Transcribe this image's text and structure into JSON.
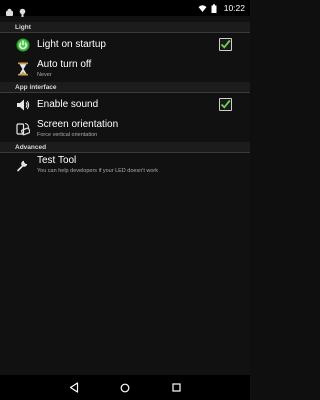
{
  "status_bar": {
    "time": "10:22",
    "icons": [
      "android-notification-icon",
      "android-notification-icon",
      "wifi-icon",
      "battery-icon"
    ]
  },
  "sections": [
    {
      "header": "Light",
      "items": [
        {
          "title": "Light on startup",
          "summary": "",
          "icon": "power-icon",
          "checked": true
        },
        {
          "title": "Auto turn off",
          "summary": "Never",
          "icon": "hourglass-icon"
        }
      ]
    },
    {
      "header": "App interface",
      "items": [
        {
          "title": "Enable sound",
          "summary": "",
          "icon": "speaker-icon",
          "checked": true
        },
        {
          "title": "Screen orientation",
          "summary": "Force vertical orientation",
          "icon": "rotate-phone-icon"
        }
      ]
    },
    {
      "header": "Advanced",
      "items": [
        {
          "title": "Test Tool",
          "summary": "You can help developers if your LED doesn't work",
          "icon": "wrench-icon"
        }
      ]
    }
  ],
  "colors": {
    "accent_green": "#3fbf3f",
    "check_green": "#6fd14f",
    "background": "#111111",
    "section_header_bg": "#1c1c1c"
  },
  "nav_bar": {
    "buttons": [
      "back-icon",
      "home-icon",
      "recents-icon"
    ]
  }
}
